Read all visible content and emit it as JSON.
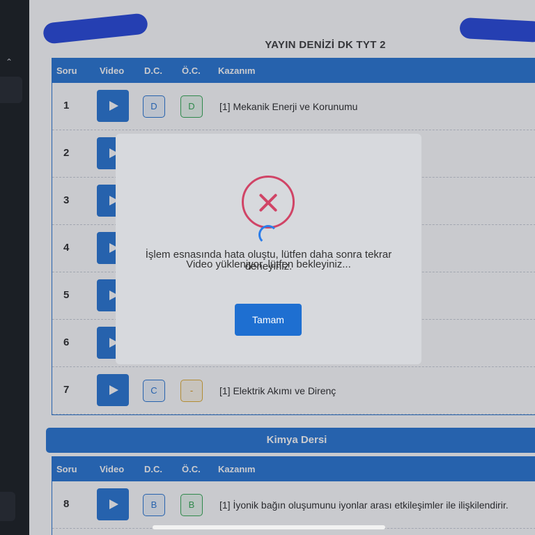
{
  "exam": {
    "title": "YAYIN DENİZİ DK TYT 2"
  },
  "table_headers": {
    "soru": "Soru",
    "video": "Video",
    "dc": "D.C.",
    "oc": "Ö.C.",
    "kazanim": "Kazanım"
  },
  "rows": [
    {
      "num": "1",
      "dc": "D",
      "oc": "D",
      "kazanim": "[1] Mekanik Enerji ve Korunumu"
    },
    {
      "num": "2"
    },
    {
      "num": "3"
    },
    {
      "num": "4"
    },
    {
      "num": "5"
    },
    {
      "num": "6"
    },
    {
      "num": "7",
      "dc": "C",
      "oc": "-",
      "kazanim": "[1] Elektrik Akımı ve Direnç"
    }
  ],
  "section2": {
    "title": "Kimya Dersi",
    "rows": [
      {
        "num": "8",
        "dc": "B",
        "oc": "B",
        "kazanim": "[1] İyonik bağın oluşumunu iyonlar arası etkileşimler ile ilişkilendirir."
      }
    ]
  },
  "modal": {
    "message": "İşlem esnasında hata oluştu, lütfen daha sonra tekrar deneyiniz.",
    "loading": "Video yükleniyor, lütfen bekleyiniz...",
    "ok_label": "Tamam"
  },
  "colors": {
    "primary": "#1e6fd1",
    "error": "#d04466",
    "success": "#2aa54a",
    "warning": "#e0a92a"
  }
}
